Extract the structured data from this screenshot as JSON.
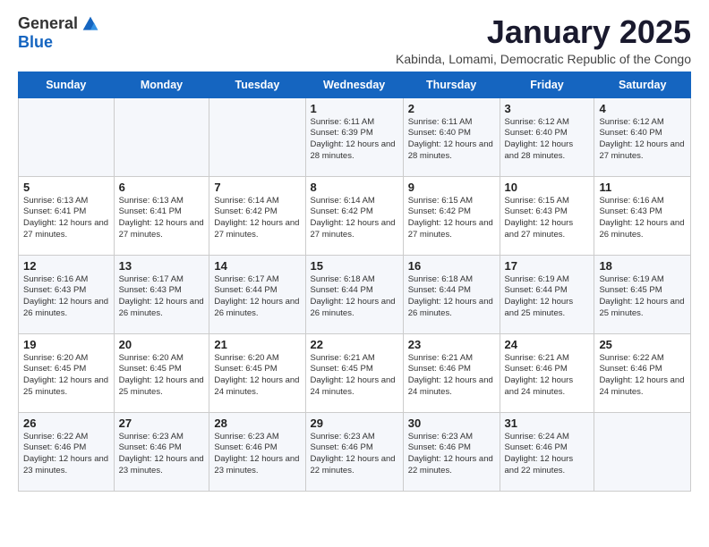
{
  "logo": {
    "general": "General",
    "blue": "Blue"
  },
  "title": "January 2025",
  "subtitle": "Kabinda, Lomami, Democratic Republic of the Congo",
  "days_of_week": [
    "Sunday",
    "Monday",
    "Tuesday",
    "Wednesday",
    "Thursday",
    "Friday",
    "Saturday"
  ],
  "weeks": [
    [
      {
        "day": "",
        "info": ""
      },
      {
        "day": "",
        "info": ""
      },
      {
        "day": "",
        "info": ""
      },
      {
        "day": "1",
        "info": "Sunrise: 6:11 AM\nSunset: 6:39 PM\nDaylight: 12 hours and 28 minutes."
      },
      {
        "day": "2",
        "info": "Sunrise: 6:11 AM\nSunset: 6:40 PM\nDaylight: 12 hours and 28 minutes."
      },
      {
        "day": "3",
        "info": "Sunrise: 6:12 AM\nSunset: 6:40 PM\nDaylight: 12 hours and 28 minutes."
      },
      {
        "day": "4",
        "info": "Sunrise: 6:12 AM\nSunset: 6:40 PM\nDaylight: 12 hours and 27 minutes."
      }
    ],
    [
      {
        "day": "5",
        "info": "Sunrise: 6:13 AM\nSunset: 6:41 PM\nDaylight: 12 hours and 27 minutes."
      },
      {
        "day": "6",
        "info": "Sunrise: 6:13 AM\nSunset: 6:41 PM\nDaylight: 12 hours and 27 minutes."
      },
      {
        "day": "7",
        "info": "Sunrise: 6:14 AM\nSunset: 6:42 PM\nDaylight: 12 hours and 27 minutes."
      },
      {
        "day": "8",
        "info": "Sunrise: 6:14 AM\nSunset: 6:42 PM\nDaylight: 12 hours and 27 minutes."
      },
      {
        "day": "9",
        "info": "Sunrise: 6:15 AM\nSunset: 6:42 PM\nDaylight: 12 hours and 27 minutes."
      },
      {
        "day": "10",
        "info": "Sunrise: 6:15 AM\nSunset: 6:43 PM\nDaylight: 12 hours and 27 minutes."
      },
      {
        "day": "11",
        "info": "Sunrise: 6:16 AM\nSunset: 6:43 PM\nDaylight: 12 hours and 26 minutes."
      }
    ],
    [
      {
        "day": "12",
        "info": "Sunrise: 6:16 AM\nSunset: 6:43 PM\nDaylight: 12 hours and 26 minutes."
      },
      {
        "day": "13",
        "info": "Sunrise: 6:17 AM\nSunset: 6:43 PM\nDaylight: 12 hours and 26 minutes."
      },
      {
        "day": "14",
        "info": "Sunrise: 6:17 AM\nSunset: 6:44 PM\nDaylight: 12 hours and 26 minutes."
      },
      {
        "day": "15",
        "info": "Sunrise: 6:18 AM\nSunset: 6:44 PM\nDaylight: 12 hours and 26 minutes."
      },
      {
        "day": "16",
        "info": "Sunrise: 6:18 AM\nSunset: 6:44 PM\nDaylight: 12 hours and 26 minutes."
      },
      {
        "day": "17",
        "info": "Sunrise: 6:19 AM\nSunset: 6:44 PM\nDaylight: 12 hours and 25 minutes."
      },
      {
        "day": "18",
        "info": "Sunrise: 6:19 AM\nSunset: 6:45 PM\nDaylight: 12 hours and 25 minutes."
      }
    ],
    [
      {
        "day": "19",
        "info": "Sunrise: 6:20 AM\nSunset: 6:45 PM\nDaylight: 12 hours and 25 minutes."
      },
      {
        "day": "20",
        "info": "Sunrise: 6:20 AM\nSunset: 6:45 PM\nDaylight: 12 hours and 25 minutes."
      },
      {
        "day": "21",
        "info": "Sunrise: 6:20 AM\nSunset: 6:45 PM\nDaylight: 12 hours and 24 minutes."
      },
      {
        "day": "22",
        "info": "Sunrise: 6:21 AM\nSunset: 6:45 PM\nDaylight: 12 hours and 24 minutes."
      },
      {
        "day": "23",
        "info": "Sunrise: 6:21 AM\nSunset: 6:46 PM\nDaylight: 12 hours and 24 minutes."
      },
      {
        "day": "24",
        "info": "Sunrise: 6:21 AM\nSunset: 6:46 PM\nDaylight: 12 hours and 24 minutes."
      },
      {
        "day": "25",
        "info": "Sunrise: 6:22 AM\nSunset: 6:46 PM\nDaylight: 12 hours and 24 minutes."
      }
    ],
    [
      {
        "day": "26",
        "info": "Sunrise: 6:22 AM\nSunset: 6:46 PM\nDaylight: 12 hours and 23 minutes."
      },
      {
        "day": "27",
        "info": "Sunrise: 6:23 AM\nSunset: 6:46 PM\nDaylight: 12 hours and 23 minutes."
      },
      {
        "day": "28",
        "info": "Sunrise: 6:23 AM\nSunset: 6:46 PM\nDaylight: 12 hours and 23 minutes."
      },
      {
        "day": "29",
        "info": "Sunrise: 6:23 AM\nSunset: 6:46 PM\nDaylight: 12 hours and 22 minutes."
      },
      {
        "day": "30",
        "info": "Sunrise: 6:23 AM\nSunset: 6:46 PM\nDaylight: 12 hours and 22 minutes."
      },
      {
        "day": "31",
        "info": "Sunrise: 6:24 AM\nSunset: 6:46 PM\nDaylight: 12 hours and 22 minutes."
      },
      {
        "day": "",
        "info": ""
      }
    ]
  ]
}
